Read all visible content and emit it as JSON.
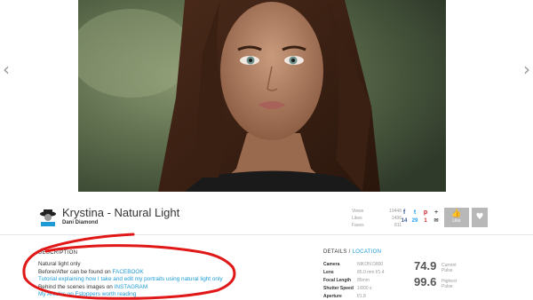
{
  "navigation": {
    "prev_icon": "‹",
    "next_icon": "›"
  },
  "photo": {
    "title": "Krystina - Natural Light",
    "author": "Dani Diamond"
  },
  "stats": [
    {
      "label": "Views",
      "value": "19448"
    },
    {
      "label": "Likes",
      "value": "1496"
    },
    {
      "label": "Faves",
      "value": "811"
    }
  ],
  "share": {
    "icons": [
      {
        "name": "facebook-icon",
        "glyph": "f",
        "color": "#3b5998"
      },
      {
        "name": "twitter-icon",
        "glyph": "t",
        "color": "#1da1f2"
      },
      {
        "name": "pinterest-icon",
        "glyph": "p",
        "color": "#cb2027"
      },
      {
        "name": "google-plus-icon",
        "glyph": "+",
        "color": "#555555"
      }
    ],
    "counts": [
      {
        "value": "14",
        "color": "#3b5998"
      },
      {
        "value": "29",
        "color": "#1da1f2"
      },
      {
        "value": "1",
        "color": "#cb2027"
      },
      {
        "value": "✉",
        "color": "#555555"
      }
    ]
  },
  "actions": {
    "like_label": "Like",
    "like_icon": "👍",
    "fave_icon": "♥"
  },
  "description": {
    "header": "DESCRIPTION",
    "line1": "Natural light only",
    "line2_prefix": "Before/After can be found on ",
    "line2_link": "FACEBOOK",
    "line3_link": "Tutorial explaining how I take and edit my portraits using natural light only",
    "line4_prefix": "Behind the scenes images on ",
    "line4_link": "INSTAGRAM",
    "line5_link": "My Articles on Fstoppers worth reading"
  },
  "details": {
    "header": "DETAILS",
    "separator": " / ",
    "location_link": "LOCATION",
    "specs": [
      {
        "key": "Camera",
        "value": "NIKON D800"
      },
      {
        "key": "Lens",
        "value": "85.0 mm f/1.4"
      },
      {
        "key": "Focal Length",
        "value": "85mm"
      },
      {
        "key": "Shutter Speed",
        "value": "1/800 s"
      },
      {
        "key": "Aperture",
        "value": "f/1.8"
      }
    ]
  },
  "pulse": {
    "current_value": "74.9",
    "current_label_1": "Current",
    "current_label_2": "Pulse",
    "highest_value": "99.6",
    "highest_label_1": "Highest",
    "highest_label_2": "Pulse"
  },
  "colors": {
    "link": "#1e9bd6",
    "annotation": "#e01818",
    "button": "#b8b8b8"
  }
}
